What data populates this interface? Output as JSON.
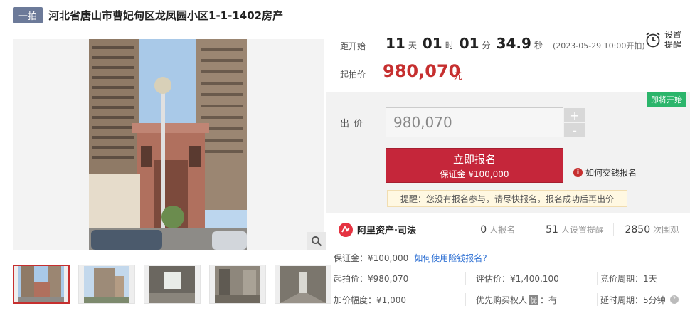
{
  "title": {
    "badge": "一拍",
    "text": "河北省唐山市曹妃甸区龙凤园小区1-1-1402房产"
  },
  "countdown": {
    "label": "距开始",
    "days": "11",
    "days_unit": "天",
    "hours": "01",
    "hours_unit": "时",
    "minutes": "01",
    "minutes_unit": "分",
    "seconds": "34.9",
    "seconds_unit": "秒",
    "start_note": "(2023-05-29 10:00开拍)"
  },
  "remind": {
    "label": "设置提醒",
    "icon": "alarm-clock-icon"
  },
  "start_price": {
    "label": "起拍价",
    "value": "980,070",
    "unit": "元"
  },
  "bid": {
    "status_badge": "即将开始",
    "label": "出价",
    "value": "980,070",
    "plus": "+",
    "minus": "-",
    "signup_main": "立即报名",
    "signup_sub": "保证金 ¥100,000",
    "howto": "如何交钱报名",
    "tip": "提醒：您没有报名参与，请尽快报名，报名成功后再出价"
  },
  "stats": {
    "brand": "阿里资产·司法",
    "signups_num": "0",
    "signups_label": "人报名",
    "reminders_num": "51",
    "reminders_label": "人设置提醒",
    "views_num": "2850",
    "views_label": "次围观"
  },
  "deposit": {
    "text": "保证金：¥100,000",
    "link": "如何使用险钱报名?"
  },
  "details": {
    "start_price": "起拍价：¥980,070",
    "appraisal": "评估价：¥1,400,100",
    "bid_cycle": "竞价周期：1天",
    "increment": "加价幅度：¥1,000",
    "priority_prefix": "优先购买权人",
    "priority_badge": "优",
    "priority_suffix": "：有",
    "delay_cycle": "延时周期：5分钟"
  },
  "colors": {
    "accent_red": "#c5263a",
    "price_red": "#c62f2f",
    "badge_green": "#2bb56b",
    "link_blue": "#2c6fd3"
  },
  "thumbnails": [
    {
      "name": "thumb-building-front"
    },
    {
      "name": "thumb-building-tower"
    },
    {
      "name": "thumb-room-window"
    },
    {
      "name": "thumb-room-interior"
    },
    {
      "name": "thumb-room-hallway"
    }
  ]
}
